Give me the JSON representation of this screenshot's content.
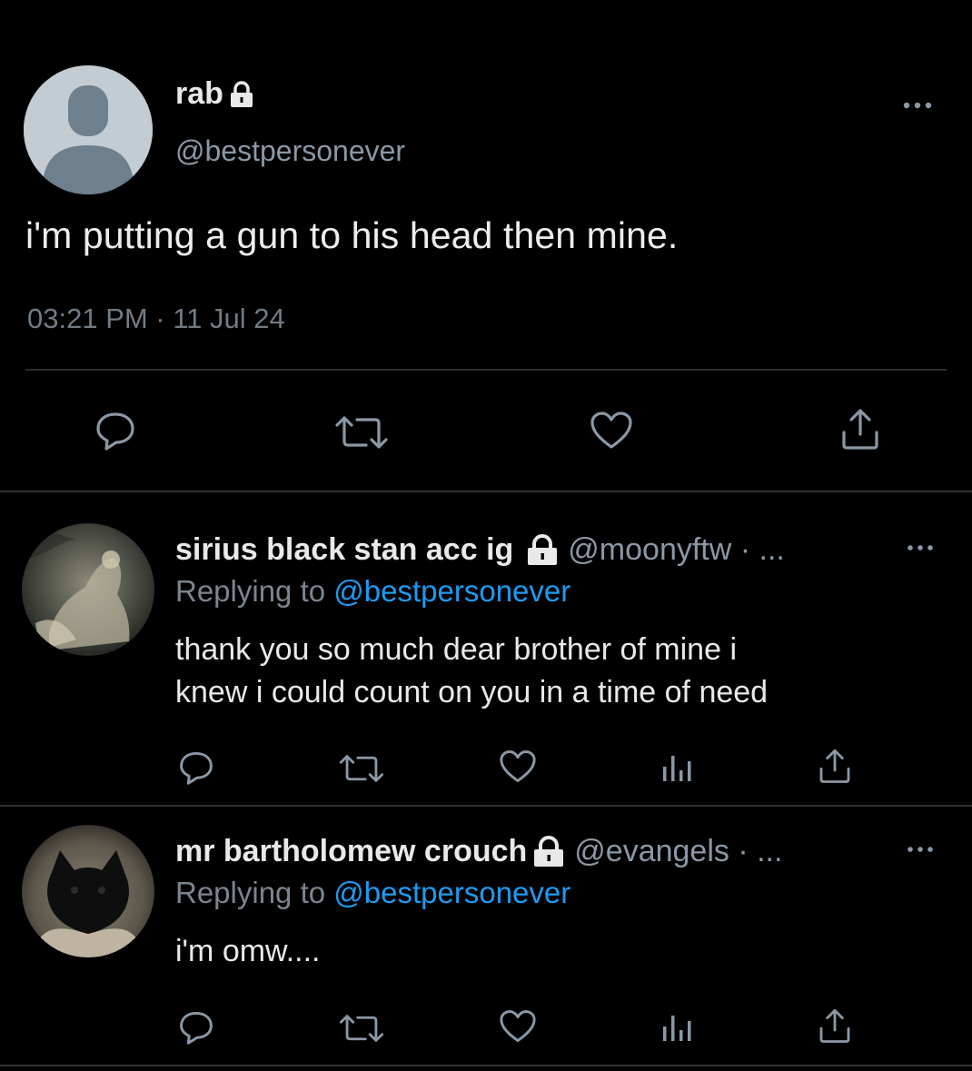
{
  "main_tweet": {
    "display_name": "rab",
    "handle": "@bestpersonever",
    "text": "i'm putting a gun to his head then mine.",
    "timestamp": "03:21 PM · 11 Jul 24",
    "icons": [
      "default-avatar-icon",
      "lock-icon",
      "more-icon",
      "reply-icon",
      "retweet-icon",
      "like-icon",
      "share-icon"
    ]
  },
  "replies": [
    {
      "display_name": "sirius black stan acc ig",
      "handle": "@moonyftw · ...",
      "replying_prefix": "Replying to ",
      "replying_to": "@bestpersonever",
      "text_lines": [
        "thank you so much dear brother of mine i",
        "knew i could count on you in a time of need"
      ]
    },
    {
      "display_name": "mr bartholomew crouch",
      "handle": "@evangels · ...",
      "replying_prefix": "Replying to ",
      "replying_to": "@bestpersonever",
      "text_lines": [
        "i'm omw...."
      ]
    }
  ],
  "colors": {
    "background": "#000000",
    "text_primary": "#e7e9ea",
    "text_secondary": "#8b98a5",
    "mention": "#1d9bf0",
    "divider": "#2f3336"
  }
}
